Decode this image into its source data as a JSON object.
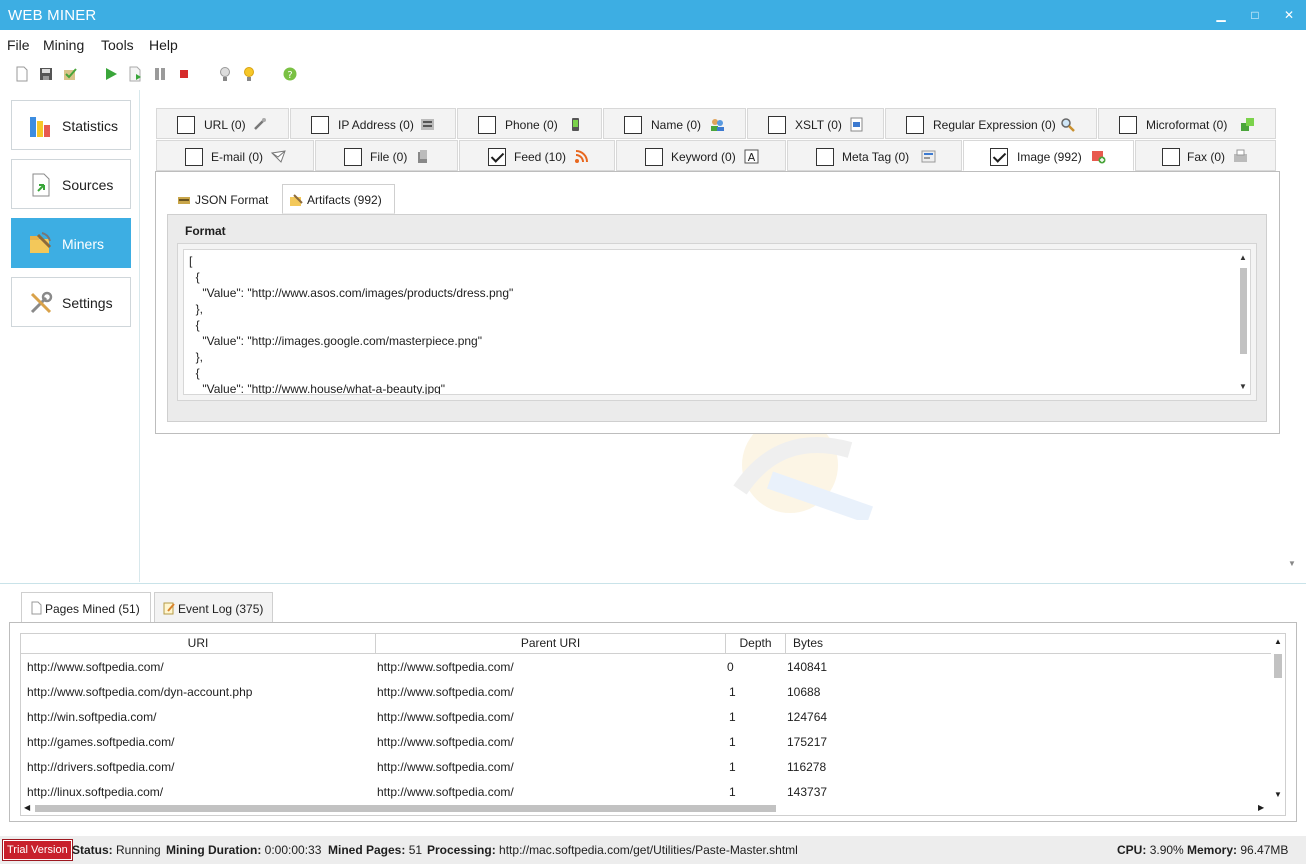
{
  "window": {
    "title": "WEB MINER",
    "min": "▁",
    "max": "□",
    "close": "✕"
  },
  "menu": [
    "File",
    "Mining",
    "Tools",
    "Help"
  ],
  "sidebar": [
    {
      "label": "Statistics",
      "icon": "bar-chart-icon",
      "active": false
    },
    {
      "label": "Sources",
      "icon": "document-arrow-icon",
      "active": false
    },
    {
      "label": "Miners",
      "icon": "folder-pickaxe-icon",
      "active": true
    },
    {
      "label": "Settings",
      "icon": "tools-icon",
      "active": false
    }
  ],
  "filters": {
    "row1": [
      {
        "label": "URL (0)",
        "checked": false,
        "icon": "link-icon"
      },
      {
        "label": "IP Address (0)",
        "checked": false,
        "icon": "ip-icon"
      },
      {
        "label": "Phone (0)",
        "checked": false,
        "icon": "phone-icon"
      },
      {
        "label": "Name (0)",
        "checked": false,
        "icon": "people-icon"
      },
      {
        "label": "XSLT (0)",
        "checked": false,
        "icon": "xslt-icon"
      },
      {
        "label": "Regular Expression (0)",
        "checked": false,
        "icon": "magnifier-icon"
      },
      {
        "label": "Microformat (0)",
        "checked": false,
        "icon": "cubes-icon"
      }
    ],
    "row2": [
      {
        "label": "E-mail (0)",
        "checked": false,
        "icon": "envelope-icon"
      },
      {
        "label": "File (0)",
        "checked": false,
        "icon": "file-icon"
      },
      {
        "label": "Feed (10)",
        "checked": true,
        "icon": "rss-icon"
      },
      {
        "label": "Keyword (0)",
        "checked": false,
        "icon": "letter-a-icon"
      },
      {
        "label": "Meta Tag (0)",
        "checked": false,
        "icon": "meta-icon"
      },
      {
        "label": "Image (992)",
        "checked": true,
        "icon": "image-add-icon"
      },
      {
        "label": "Fax (0)",
        "checked": false,
        "icon": "fax-icon"
      }
    ]
  },
  "subtabs": [
    "JSON Format",
    "Artifacts (992)"
  ],
  "format": {
    "legend": "Format",
    "lines": [
      "[",
      "  {",
      "    \"Value\": \"http://www.asos.com/images/products/dress.png\"",
      "  },",
      "  {",
      "    \"Value\": \"http://images.google.com/masterpiece.png\"",
      "  },",
      "  {",
      "    \"Value\": \"http://www.house/what-a-beauty.jpg\""
    ]
  },
  "bottomtabs": [
    "Pages Mined (51)",
    "Event Log (375)"
  ],
  "grid": {
    "columns": [
      "URI",
      "Parent URI",
      "Depth",
      "Bytes"
    ],
    "rows": [
      [
        "http://www.softpedia.com/",
        "http://www.softpedia.com/",
        "0",
        "140841"
      ],
      [
        "http://www.softpedia.com/dyn-account.php",
        "http://www.softpedia.com/",
        "1",
        "10688"
      ],
      [
        "http://win.softpedia.com/",
        "http://www.softpedia.com/",
        "1",
        "124764"
      ],
      [
        "http://games.softpedia.com/",
        "http://www.softpedia.com/",
        "1",
        "175217"
      ],
      [
        "http://drivers.softpedia.com/",
        "http://www.softpedia.com/",
        "1",
        "116278"
      ],
      [
        "http://linux.softpedia.com/",
        "http://www.softpedia.com/",
        "1",
        "143737"
      ]
    ]
  },
  "status": {
    "trial": "Trial Version",
    "status_label": "Status:",
    "status_value": "Running",
    "duration_label": "Mining Duration:",
    "duration_value": "0:00:00:33",
    "pages_label": "Mined Pages:",
    "pages_value": "51",
    "processing_label": "Processing:",
    "processing_value": "http://mac.softpedia.com/get/Utilities/Paste-Master.shtml",
    "cpu_label": "CPU:",
    "cpu_value": "3.90%",
    "memory_label": "Memory:",
    "memory_value": "96.47MB"
  },
  "colors": {
    "accent": "#3daee3",
    "trial": "#c8202b"
  }
}
